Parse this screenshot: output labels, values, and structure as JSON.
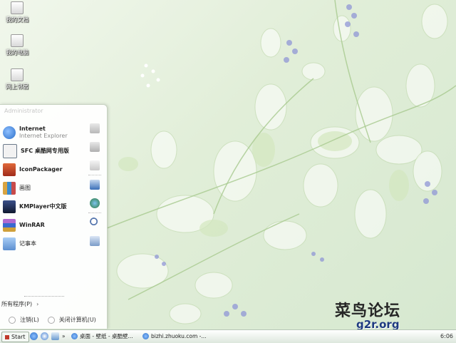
{
  "desktop_icons": [
    {
      "label": "我的文档",
      "icon": "my-documents-icon"
    },
    {
      "label": "我的电脑",
      "icon": "my-computer-icon"
    },
    {
      "label": "网上邻居",
      "icon": "network-places-icon"
    }
  ],
  "start_menu": {
    "user": "Administrator",
    "programs": [
      {
        "label": "Internet",
        "sub": "Internet Explorer",
        "icon": "internet-explorer-icon",
        "color": "#2a6fc9"
      },
      {
        "label": "SFC 桌酷网专用版",
        "sub": "",
        "icon": "sfc-icon",
        "color": "#6b7a8a"
      },
      {
        "label": "IconPackager",
        "sub": "",
        "icon": "iconpackager-icon",
        "color": "#c0392b"
      },
      {
        "label": "画图",
        "sub": "",
        "icon": "paint-icon",
        "color": "#d9a441"
      },
      {
        "label": "KMPlayer中文版",
        "sub": "",
        "icon": "kmplayer-icon",
        "color": "#1f2f5a"
      },
      {
        "label": "WinRAR",
        "sub": "",
        "icon": "winrar-icon",
        "color": "#7a3b9a"
      },
      {
        "label": "记事本",
        "sub": "",
        "icon": "notepad-icon",
        "color": "#5d8fd0"
      }
    ],
    "side_icons": [
      "folder-icon",
      "computer-icon",
      "control-panel-icon",
      "settings-icon",
      "globe-icon",
      "search-icon",
      "run-icon"
    ],
    "all_programs": "所有程序(P)",
    "logoff": "注销(L)",
    "shutdown": "关闭计算机(U)"
  },
  "taskbar": {
    "start": "Start",
    "quick_launch": [
      "ie-icon",
      "media-icon",
      "desktop-icon"
    ],
    "overflow": "»",
    "tasks": [
      {
        "label": "桌面 - 壁纸 - 桌酷壁...",
        "icon": "ie-icon"
      },
      {
        "label": "bizhi.zhuoku.com -...",
        "icon": "ie-icon"
      }
    ],
    "clock": "6:06"
  },
  "watermark": {
    "text": "菜鸟论坛",
    "url": "g2r.org"
  },
  "colors": {
    "desktop": "#e3efdc",
    "taskbar": "#e6eee6",
    "accent": "#2a6fc9"
  }
}
